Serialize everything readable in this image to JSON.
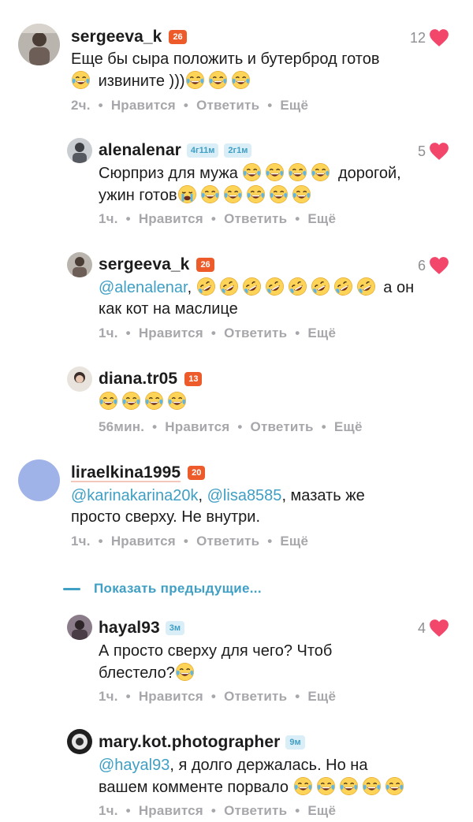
{
  "comments": [
    {
      "user": "sergeeva_k",
      "level": "26",
      "likes": "12",
      "line1": "Еще бы сыра положить и бутерброд готов",
      "line2": "извините )))",
      "time": "2ч.",
      "like": "Нравится",
      "reply": "Ответить",
      "more": "Ещё"
    },
    {
      "user": "alenalenar",
      "tag1": "4г11м",
      "tag2": "2г1м",
      "likes": "5",
      "line1": "Сюрприз для мужа",
      "line1b": "дорогой,",
      "line2": "ужин готов",
      "time": "1ч.",
      "like": "Нравится",
      "reply": "Ответить",
      "more": "Ещё"
    },
    {
      "user": "sergeeva_k",
      "level": "26",
      "likes": "6",
      "mention": "@alenalenar",
      "line1b": ", ",
      "line1c": "а он",
      "line2": "как кот на маслице",
      "time": "1ч.",
      "like": "Нравится",
      "reply": "Ответить",
      "more": "Ещё"
    },
    {
      "user": "diana.tr05",
      "level": "13",
      "time": "56мин.",
      "like": "Нравится",
      "reply": "Ответить",
      "more": "Ещё"
    },
    {
      "user": "liraelkina1995",
      "level": "20",
      "mention1": "@karinakarina20k",
      "sep": ", ",
      "mention2": "@lisa8585",
      "line1b": ", мазать же",
      "line2": "просто сверху. Не внутри.",
      "time": "1ч.",
      "like": "Нравится",
      "reply": "Ответить",
      "more": "Ещё"
    },
    {
      "user": "hayal93",
      "tag": "3м",
      "likes": "4",
      "line1": "А просто сверху для чего? Чтоб",
      "line2": "блестело?",
      "time": "1ч.",
      "like": "Нравится",
      "reply": "Ответить",
      "more": "Ещё"
    },
    {
      "user": "mary.kot.photographer",
      "tag": "9м",
      "mention": "@hayal93",
      "line1b": ", я долго держалась. Но на",
      "line2": "вашем комменте порвало",
      "time": "1ч.",
      "like": "Нравится",
      "reply": "Ответить",
      "more": "Ещё"
    }
  ],
  "show_previous": "Показать предыдущие...",
  "dot": "•",
  "colors": {
    "accent": "#3f9fc4",
    "level_badge": "#ee5b2a",
    "heart": "#f2476b",
    "meta": "#a7a7ab"
  },
  "icons": {
    "like": "heart-icon",
    "emoji_laugh": "tears-of-joy-emoji",
    "emoji_rofl": "rofl-emoji",
    "emoji_cry": "crying-emoji"
  }
}
